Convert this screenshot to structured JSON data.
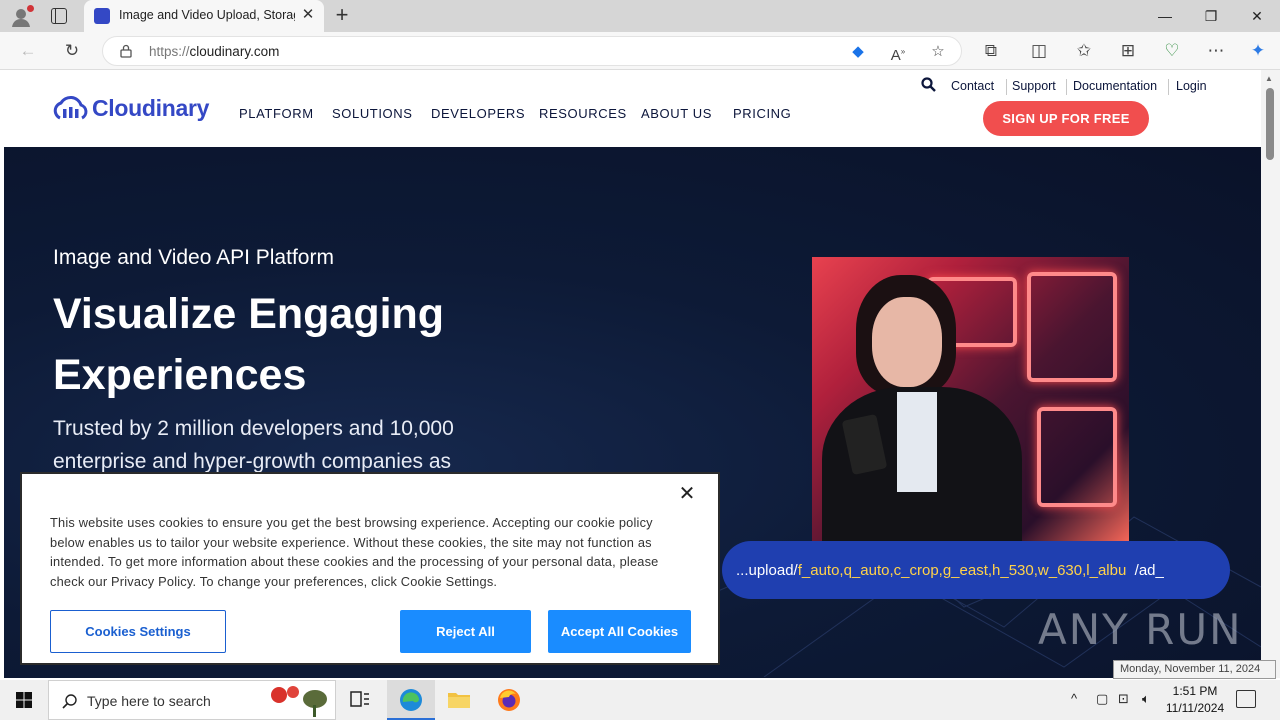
{
  "browser": {
    "tab_title": "Image and Video Upload, Storage, Optimization and CDN",
    "url_scheme": "https://",
    "url_host": "cloudinary.com"
  },
  "site": {
    "logo_text": "Cloudinary",
    "nav": [
      "PLATFORM",
      "SOLUTIONS",
      "DEVELOPERS",
      "RESOURCES",
      "ABOUT US",
      "PRICING"
    ],
    "utility_links": [
      "Contact",
      "Support",
      "Documentation",
      "Login"
    ],
    "signup_label": "SIGN UP FOR FREE",
    "brand_color": "#3448c5",
    "cta_color": "#f14e4e"
  },
  "hero": {
    "eyebrow": "Image and Video API Platform",
    "title": "Visualize Engaging Experiences",
    "subtitle": "Trusted by 2 million developers and 10,000 enterprise and hyper-growth companies as",
    "url_prefix": "...upload/",
    "url_params": "f_auto,q_auto,c_crop,g_east,h_530,w_630,l_albu",
    "url_suffix": "/ad_"
  },
  "cookie_banner": {
    "text": "This website uses cookies to ensure you get the best browsing experience. Accepting our cookie policy below enables us to tailor your website experience. Without these cookies, the site may not function as intended. To get more information about these cookies and the processing of your personal data, please check our Privacy Policy. To change your preferences, click Cookie Settings.",
    "settings_label": "Cookies Settings",
    "reject_label": "Reject All",
    "accept_label": "Accept All Cookies",
    "button_color": "#1a8cff"
  },
  "watermark": "ANY RUN",
  "tooltip_date": "Monday, November 11, 2024",
  "taskbar": {
    "search_placeholder": "Type here to search",
    "time": "1:51 PM",
    "date": "11/11/2024"
  }
}
